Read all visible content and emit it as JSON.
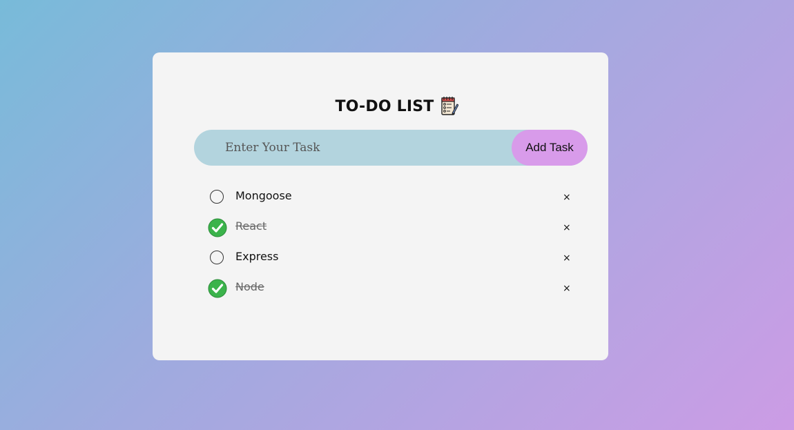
{
  "header": {
    "title": "TO-DO LIST"
  },
  "input": {
    "placeholder": "Enter Your Task",
    "value": "",
    "add_label": "Add Task"
  },
  "tasks": [
    {
      "label": "Mongoose",
      "done": false
    },
    {
      "label": "React",
      "done": true
    },
    {
      "label": "Express",
      "done": false
    },
    {
      "label": "Node",
      "done": true
    }
  ],
  "delete_symbol": "×",
  "colors": {
    "card_background": "#f4f4f4",
    "input_background": "#b3d4de",
    "button_background": "#d89bea",
    "check_green": "#3bb34b",
    "gradient_start": "#78bbd9",
    "gradient_end": "#cc9ce5"
  },
  "icons": {
    "title_icon": "notepad-checklist-icon",
    "done_icon": "green-check-icon",
    "todo_icon": "empty-circle-icon",
    "delete_icon": "close-x-icon"
  }
}
